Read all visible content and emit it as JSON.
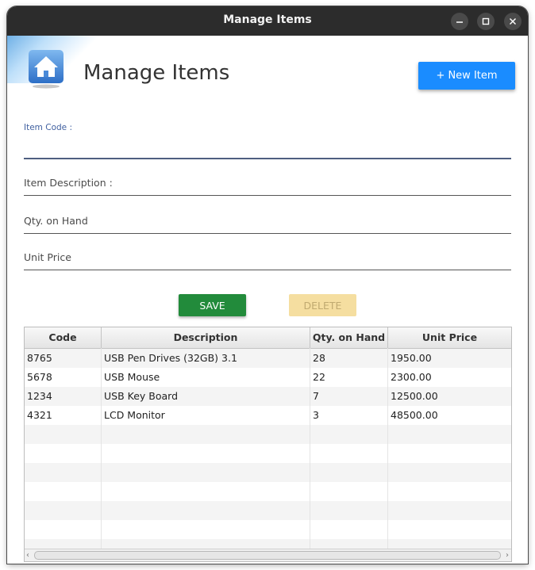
{
  "window": {
    "title": "Manage Items"
  },
  "header": {
    "title": "Manage Items",
    "new_button": "+ New Item"
  },
  "form": {
    "item_code_label": "Item Code :",
    "item_description_label": "Item Description :",
    "qty_label": "Qty. on Hand",
    "unit_price_label": "Unit Price"
  },
  "actions": {
    "save": "SAVE",
    "delete": "DELETE"
  },
  "table": {
    "columns": [
      "Code",
      "Description",
      "Qty. on Hand",
      "Unit Price"
    ],
    "rows": [
      [
        "8765",
        "USB Pen Drives (32GB) 3.1",
        "28",
        "1950.00"
      ],
      [
        "5678",
        "USB Mouse",
        "22",
        "2300.00"
      ],
      [
        "1234",
        "USB Key Board",
        "7",
        "12500.00"
      ],
      [
        "4321",
        "LCD Monitor",
        "3",
        "48500.00"
      ]
    ]
  },
  "colors": {
    "accent": "#1a8cff",
    "save": "#228b3b",
    "delete": "#f5dea0",
    "titlebar": "#2c2c2c"
  },
  "icons": [
    "home-icon",
    "minimize-icon",
    "maximize-icon",
    "close-icon",
    "chevron-left-icon",
    "chevron-right-icon"
  ]
}
